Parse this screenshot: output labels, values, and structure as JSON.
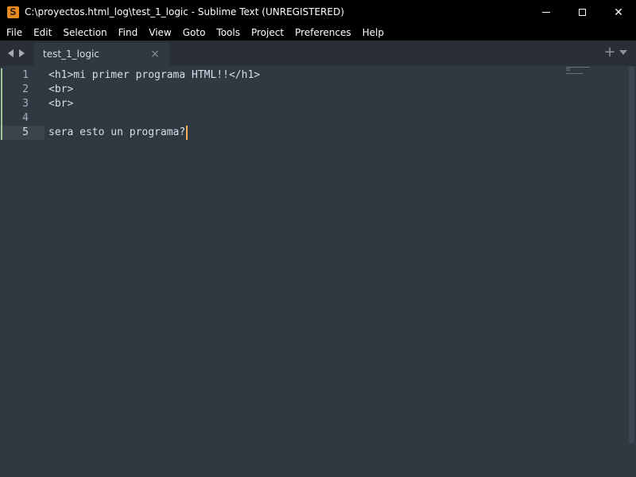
{
  "window": {
    "title": "C:\\proyectos.html_log\\test_1_logic - Sublime Text (UNREGISTERED)",
    "app_icon_letter": "S",
    "controls": {
      "minimize": "minimize-icon",
      "maximize": "maximize-icon",
      "close": "close-icon",
      "close_glyph": "✕"
    }
  },
  "menu": {
    "items": [
      "File",
      "Edit",
      "Selection",
      "Find",
      "View",
      "Goto",
      "Tools",
      "Project",
      "Preferences",
      "Help"
    ]
  },
  "tabs": {
    "active": {
      "label": "test_1_logic",
      "close_glyph": "×"
    },
    "add_glyph": "+"
  },
  "editor": {
    "current_line": 5,
    "line_numbers": [
      "1",
      "2",
      "3",
      "4",
      "5"
    ],
    "lines": [
      "<h1>mi primer programa HTML!!</h1>",
      "<br>",
      "<br>",
      "",
      "sera esto un programa?"
    ]
  },
  "colors": {
    "background": "#303841",
    "titlebar": "#000000",
    "text": "#d8dee9",
    "cursor": "#f9ae58",
    "modified_marker": "#99c794"
  }
}
